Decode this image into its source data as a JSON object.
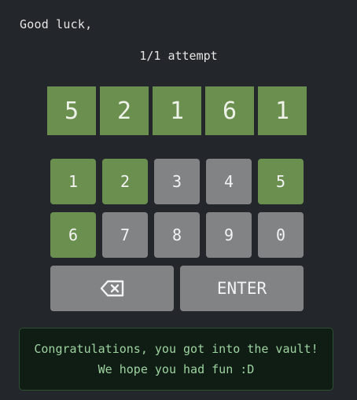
{
  "greeting": "Good luck,",
  "attempts": "1/1 attempt",
  "code_digits": [
    "5",
    "2",
    "1",
    "6",
    "1"
  ],
  "keypad": {
    "row1": [
      {
        "label": "1",
        "state": "correct"
      },
      {
        "label": "2",
        "state": "correct"
      },
      {
        "label": "3",
        "state": "unused"
      },
      {
        "label": "4",
        "state": "unused"
      },
      {
        "label": "5",
        "state": "correct"
      }
    ],
    "row2": [
      {
        "label": "6",
        "state": "correct"
      },
      {
        "label": "7",
        "state": "unused"
      },
      {
        "label": "8",
        "state": "unused"
      },
      {
        "label": "9",
        "state": "unused"
      },
      {
        "label": "0",
        "state": "unused"
      }
    ],
    "backspace_icon": "backspace-icon",
    "enter_label": "ENTER"
  },
  "message": {
    "line1": "Congratulations, you got into the vault!",
    "line2": "We hope you had fun :D"
  },
  "colors": {
    "background": "#23262b",
    "correct": "#6a8f4f",
    "unused": "#828385",
    "message_text": "#9ed3a0"
  }
}
